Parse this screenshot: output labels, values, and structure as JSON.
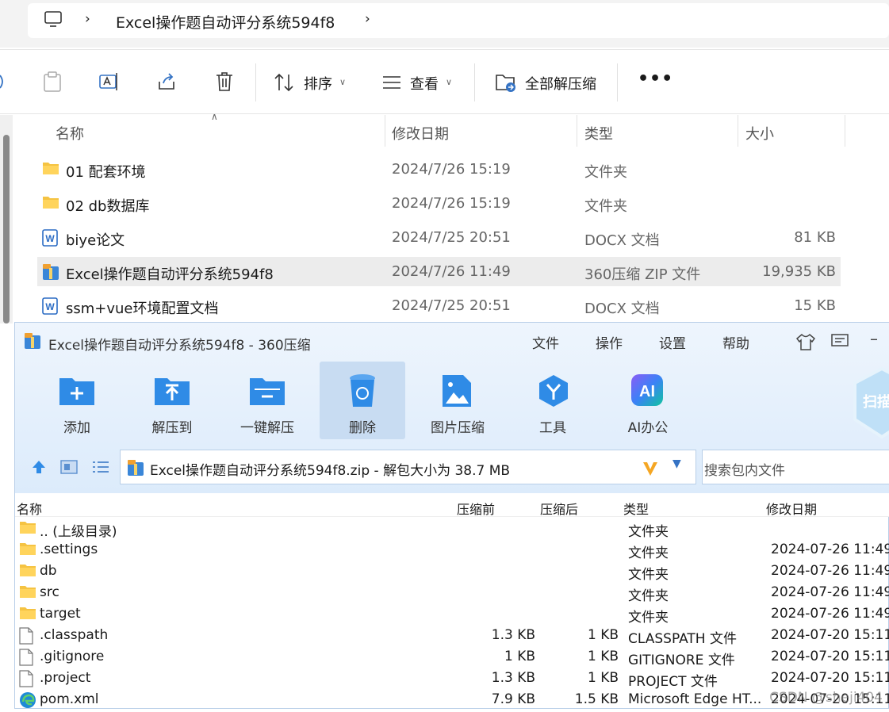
{
  "explorer": {
    "breadcrumb": [
      "Excel操作题自动评分系统594f8"
    ],
    "toolbar": {
      "sort": "排序",
      "view": "查看",
      "extract_all": "全部解压缩"
    },
    "columns": {
      "name": "名称",
      "modified": "修改日期",
      "type": "类型",
      "size": "大小"
    },
    "rows": [
      {
        "name": "01 配套环境",
        "modified": "2024/7/26 15:19",
        "type": "文件夹",
        "size": "",
        "icon": "folder-icon"
      },
      {
        "name": "02 db数据库",
        "modified": "2024/7/26 15:19",
        "type": "文件夹",
        "size": "",
        "icon": "folder-icon"
      },
      {
        "name": "biye论文",
        "modified": "2024/7/25 20:51",
        "type": "DOCX 文档",
        "size": "81 KB",
        "icon": "word-doc-icon"
      },
      {
        "name": "Excel操作题自动评分系统594f8",
        "modified": "2024/7/26 11:49",
        "type": "360压缩 ZIP 文件",
        "size": "19,935 KB",
        "icon": "zip-archive-icon",
        "selected": true
      },
      {
        "name": "ssm+vue环境配置文档",
        "modified": "2024/7/25 20:51",
        "type": "DOCX 文档",
        "size": "15 KB",
        "icon": "word-doc-icon"
      }
    ]
  },
  "zip": {
    "title": "Excel操作题自动评分系统594f8 - 360压缩",
    "menu": [
      "文件",
      "操作",
      "设置",
      "帮助"
    ],
    "tools": [
      "添加",
      "解压到",
      "一键解压",
      "删除",
      "图片压缩",
      "工具",
      "AI办公"
    ],
    "scan_label": "扫描",
    "path": "Excel操作题自动评分系统594f8.zip - 解包大小为 38.7 MB",
    "search_placeholder": "搜索包内文件",
    "columns": {
      "name": "名称",
      "before": "压缩前",
      "after": "压缩后",
      "type": "类型",
      "modified": "修改日期"
    },
    "rows": [
      {
        "name": ".. (上级目录)",
        "before": "",
        "after": "",
        "type": "文件夹",
        "modified": "",
        "icon": "folder-icon"
      },
      {
        "name": ".settings",
        "before": "",
        "after": "",
        "type": "文件夹",
        "modified": "2024-07-26 11:49",
        "icon": "folder-icon"
      },
      {
        "name": "db",
        "before": "",
        "after": "",
        "type": "文件夹",
        "modified": "2024-07-26 11:49",
        "icon": "folder-icon"
      },
      {
        "name": "src",
        "before": "",
        "after": "",
        "type": "文件夹",
        "modified": "2024-07-26 11:49",
        "icon": "folder-icon"
      },
      {
        "name": "target",
        "before": "",
        "after": "",
        "type": "文件夹",
        "modified": "2024-07-26 11:49",
        "icon": "folder-icon"
      },
      {
        "name": ".classpath",
        "before": "1.3 KB",
        "after": "1 KB",
        "type": "CLASSPATH 文件",
        "modified": "2024-07-20 15:11",
        "icon": "file-icon"
      },
      {
        "name": ".gitignore",
        "before": "1 KB",
        "after": "1 KB",
        "type": "GITIGNORE 文件",
        "modified": "2024-07-20 15:11",
        "icon": "file-icon"
      },
      {
        "name": ".project",
        "before": "1.3 KB",
        "after": "1 KB",
        "type": "PROJECT 文件",
        "modified": "2024-07-20 15:11",
        "icon": "file-icon"
      },
      {
        "name": "pom.xml",
        "before": "7.9 KB",
        "after": "1.5 KB",
        "type": "Microsoft Edge HT...",
        "modified": "2024-07-20 15:11",
        "icon": "edge-icon"
      }
    ]
  },
  "watermark": "CSDN @sheji404",
  "colors": {
    "folder": "#f5c342",
    "accent": "#2f8be6",
    "selection": "#ececec"
  }
}
